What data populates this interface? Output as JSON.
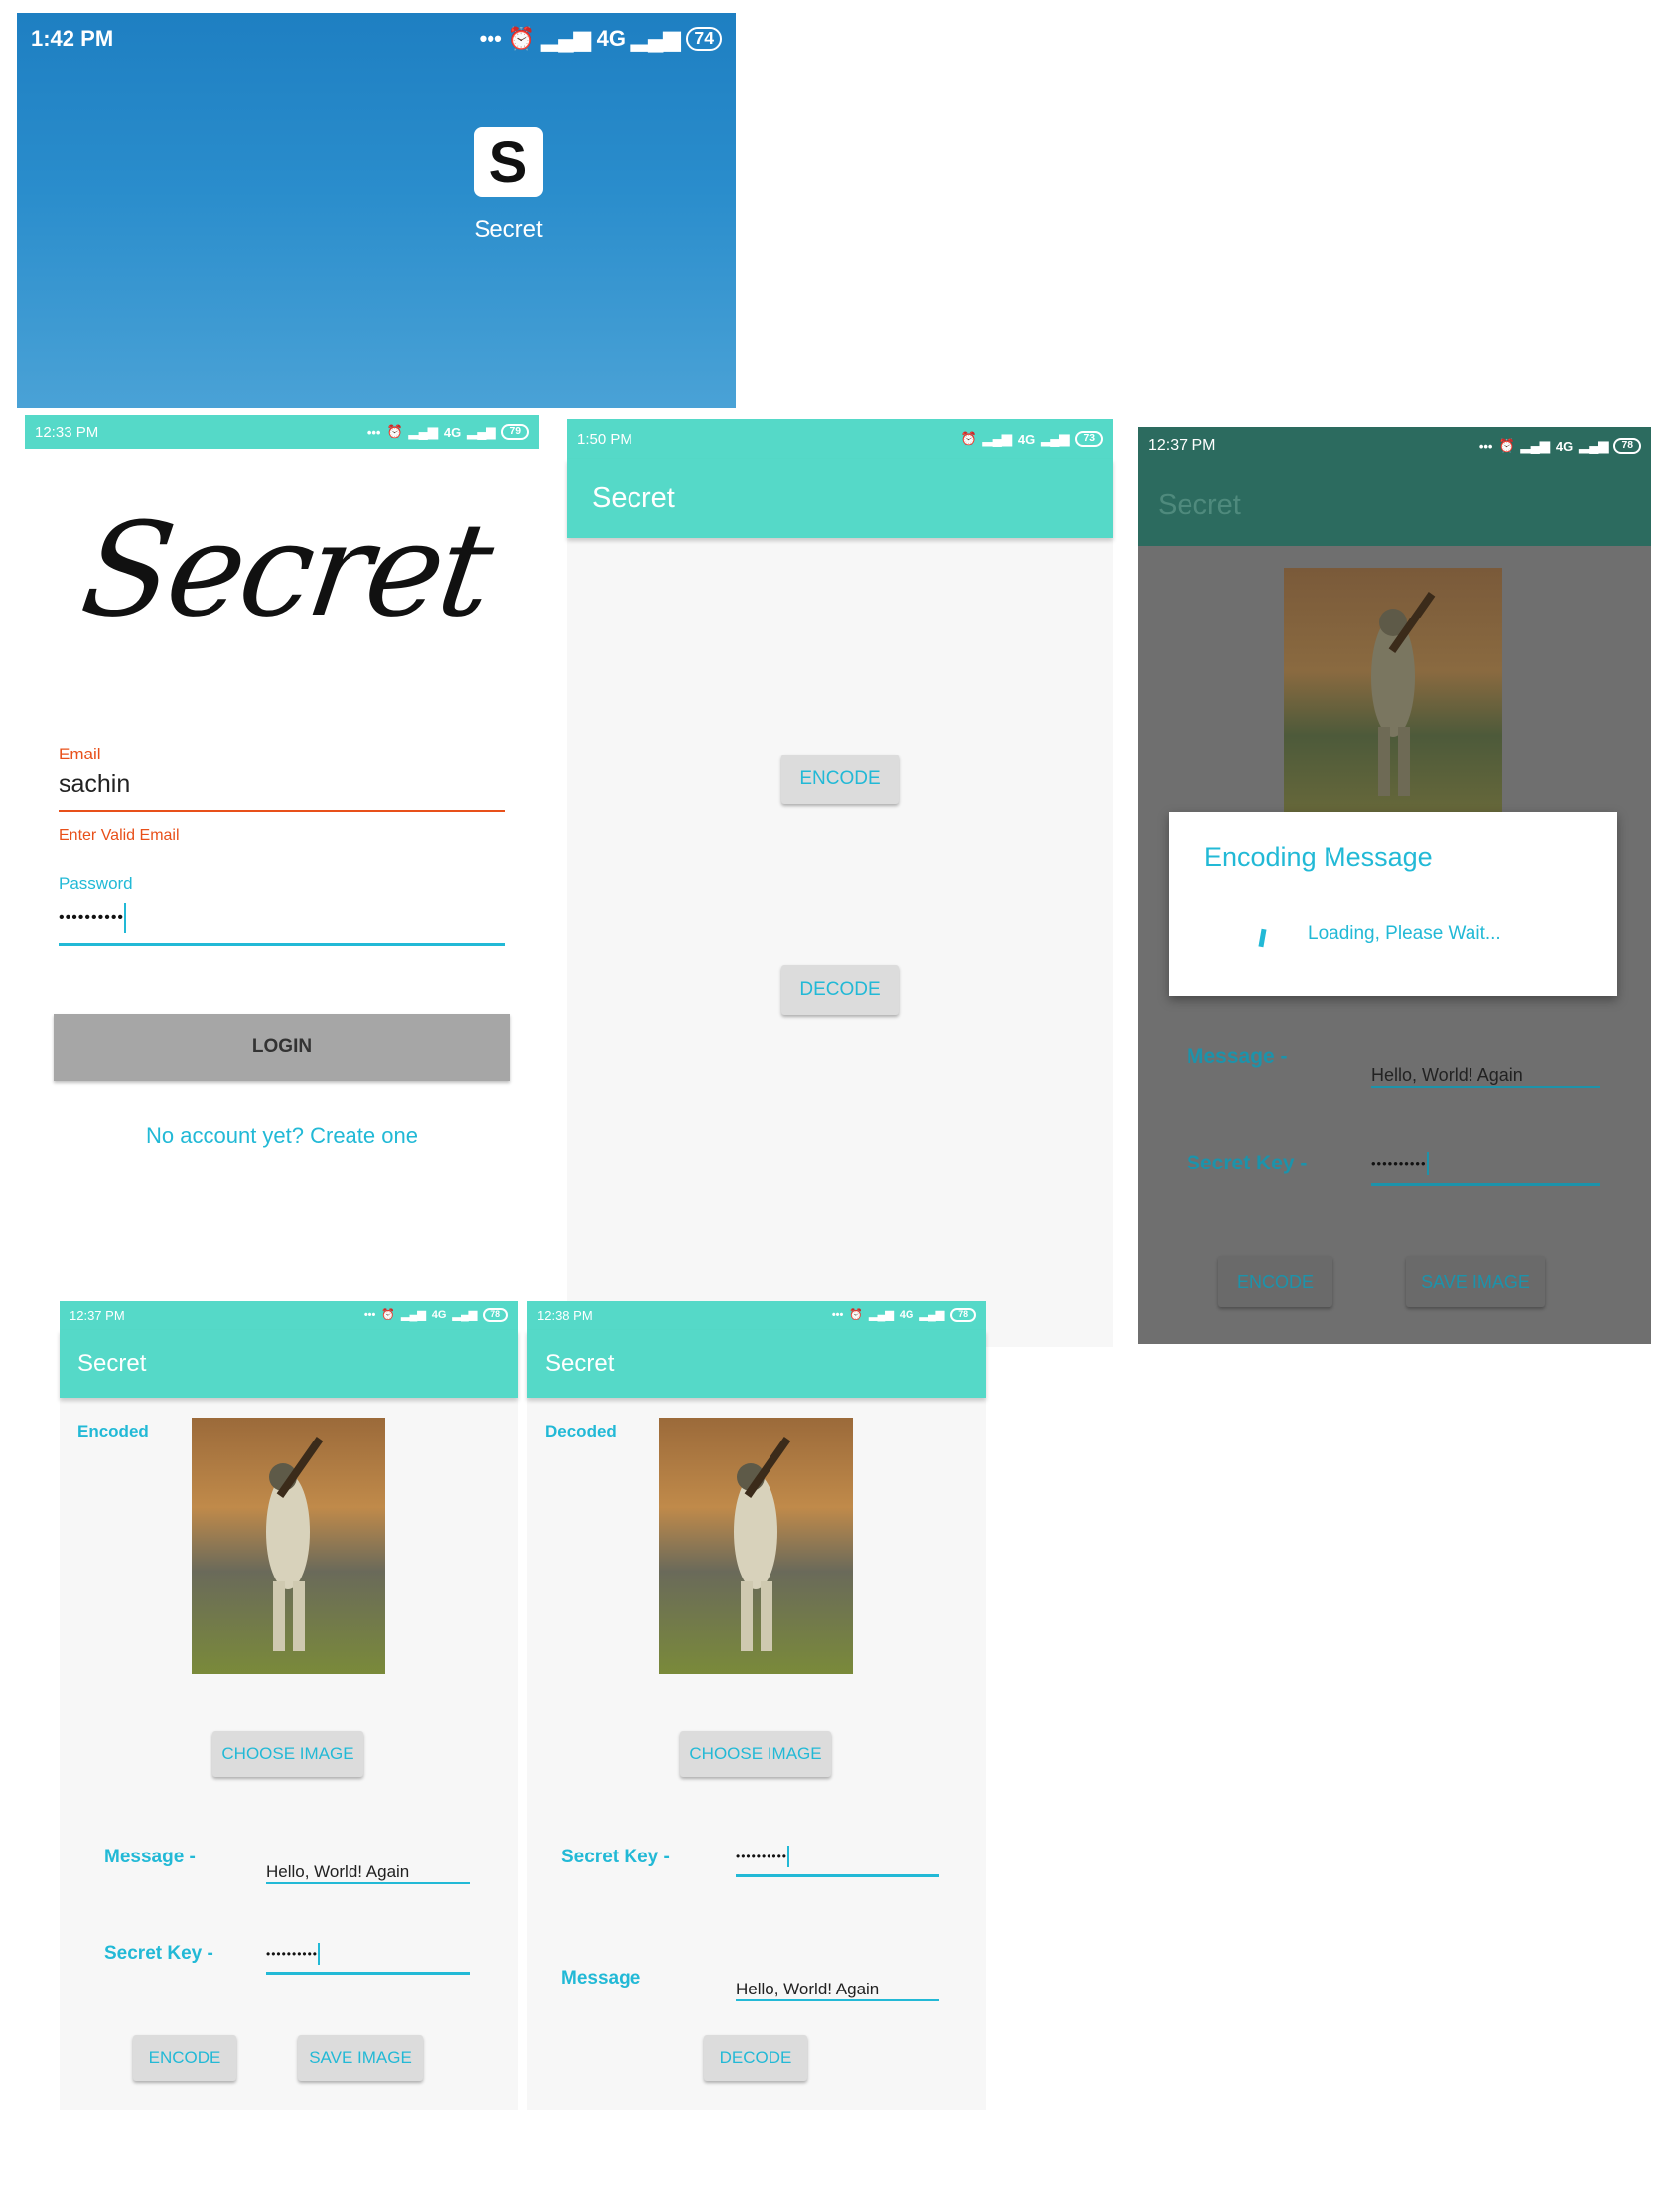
{
  "home": {
    "time": "1:42 PM",
    "signal": "4G",
    "battery": "74",
    "app_icon_letter": "S",
    "app_name": "Secret"
  },
  "login": {
    "time": "12:33 PM",
    "signal": "4G",
    "battery": "79",
    "logo_text": "Secret",
    "email_label": "Email",
    "email_value": "sachin",
    "email_error": "Enter Valid Email",
    "password_label": "Password",
    "password_value": "••••••••••",
    "login_button": "LOGIN",
    "create_account_link": "No account yet? Create one"
  },
  "menu": {
    "time": "1:50 PM",
    "signal": "4G",
    "battery": "73",
    "title": "Secret",
    "encode_button": "ENCODE",
    "decode_button": "DECODE"
  },
  "encoding_dialog_screen": {
    "time": "12:37 PM",
    "signal": "4G",
    "battery": "78",
    "title": "Secret",
    "dialog_title": "Encoding Message",
    "dialog_text": "Loading, Please Wait...",
    "message_label": "Message -",
    "message_value": "Hello, World!  Again",
    "secret_key_label": "Secret Key -",
    "secret_key_value": "••••••••••",
    "encode_button": "ENCODE",
    "save_image_button": "SAVE IMAGE"
  },
  "encode_screen": {
    "time": "12:37 PM",
    "signal": "4G",
    "battery": "78",
    "title": "Secret",
    "status_label": "Encoded",
    "choose_image_button": "CHOOSE IMAGE",
    "message_label": "Message -",
    "message_value": "Hello, World!  Again",
    "secret_key_label": "Secret Key -",
    "secret_key_value": "••••••••••",
    "encode_button": "ENCODE",
    "save_image_button": "SAVE IMAGE"
  },
  "decode_screen": {
    "time": "12:38 PM",
    "signal": "4G",
    "battery": "78",
    "title": "Secret",
    "status_label": "Decoded",
    "choose_image_button": "CHOOSE IMAGE",
    "secret_key_label": "Secret Key -",
    "secret_key_value": "••••••••••",
    "message_label": "Message",
    "message_value": "Hello, World!  Again",
    "decode_button": "DECODE"
  },
  "colors": {
    "accent": "#22b9d6",
    "app_bar": "#55d9c8",
    "error": "#e8501a"
  }
}
